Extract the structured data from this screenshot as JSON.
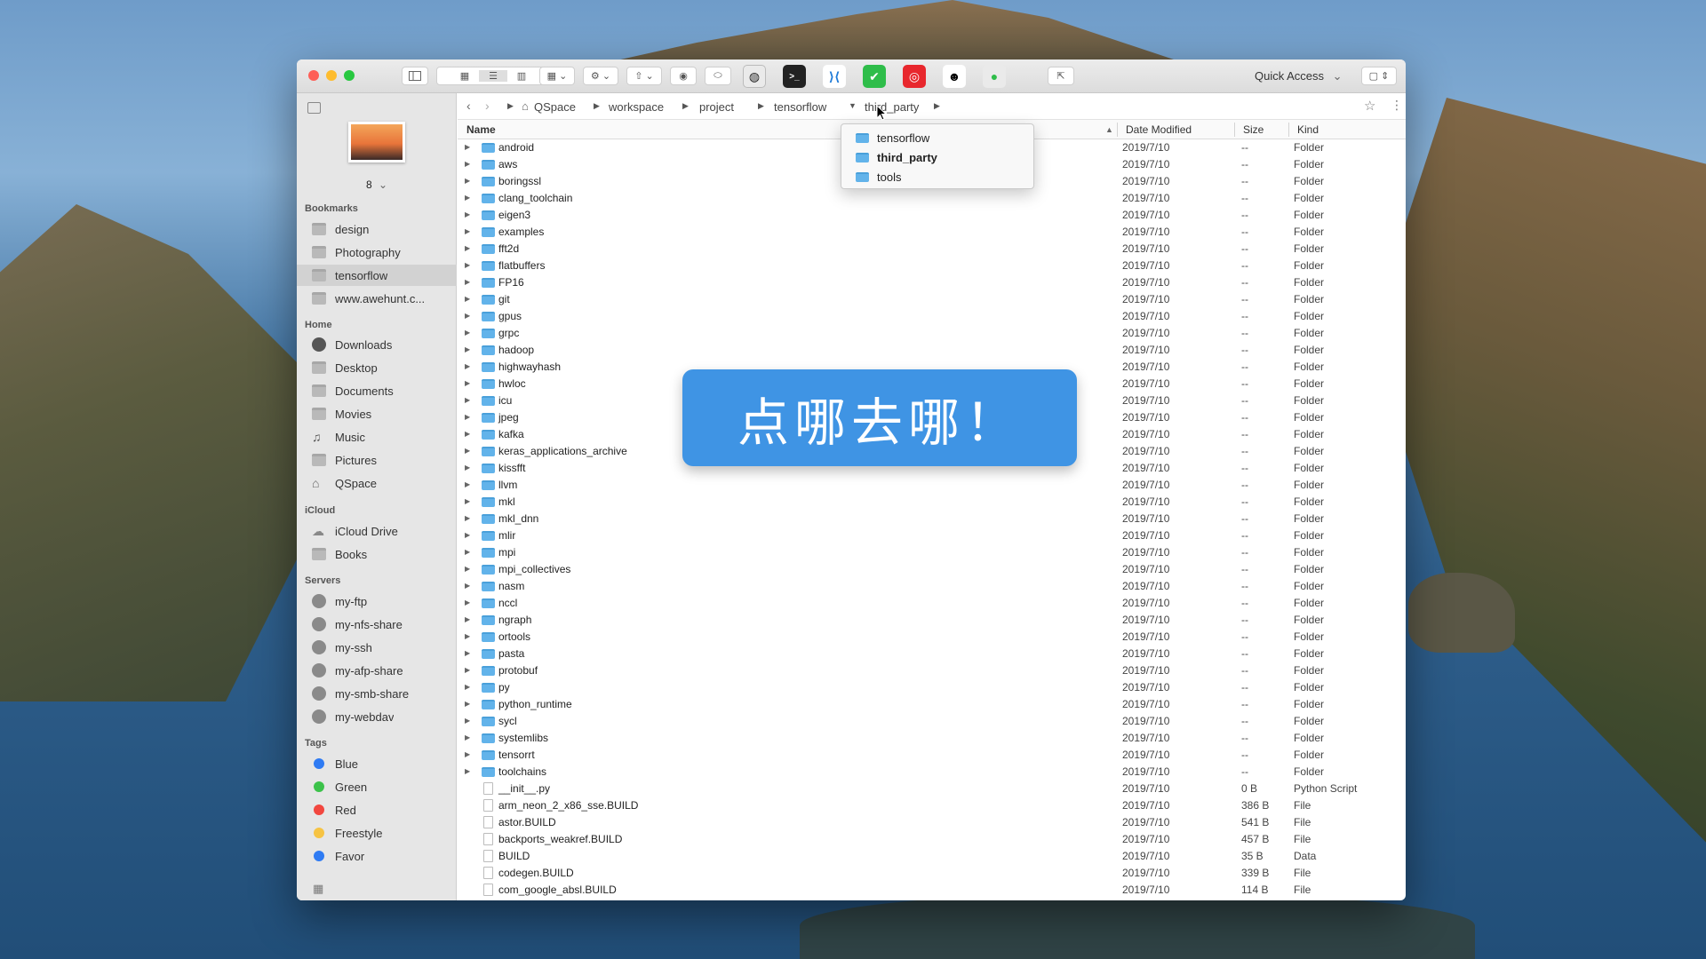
{
  "toolbar": {
    "quick_access_label": "Quick Access",
    "quick_access_chevron": "chevron-down-icon"
  },
  "sidebar": {
    "thumbnail_count": "8",
    "bookmarks_header": "Bookmarks",
    "bookmarks": [
      {
        "label": "design",
        "selected": false
      },
      {
        "label": "Photography",
        "selected": false
      },
      {
        "label": "tensorflow",
        "selected": true
      },
      {
        "label": "www.awehunt.c...",
        "selected": false
      }
    ],
    "home_header": "Home",
    "home": [
      {
        "label": "Downloads",
        "icon": "download-icon"
      },
      {
        "label": "Desktop",
        "icon": "desktop-icon"
      },
      {
        "label": "Documents",
        "icon": "documents-icon"
      },
      {
        "label": "Movies",
        "icon": "movies-icon"
      },
      {
        "label": "Music",
        "icon": "music-icon"
      },
      {
        "label": "Pictures",
        "icon": "pictures-icon"
      },
      {
        "label": "QSpace",
        "icon": "home-icon"
      }
    ],
    "icloud_header": "iCloud",
    "icloud": [
      {
        "label": "iCloud Drive",
        "icon": "cloud-icon"
      },
      {
        "label": "Books",
        "icon": "books-icon"
      }
    ],
    "servers_header": "Servers",
    "servers": [
      {
        "label": "my-ftp"
      },
      {
        "label": "my-nfs-share"
      },
      {
        "label": "my-ssh"
      },
      {
        "label": "my-afp-share"
      },
      {
        "label": "my-smb-share"
      },
      {
        "label": "my-webdav"
      }
    ],
    "tags_header": "Tags",
    "tags": [
      {
        "label": "Blue",
        "color": "#2f7bf3"
      },
      {
        "label": "Green",
        "color": "#3cc24a"
      },
      {
        "label": "Red",
        "color": "#f2473f"
      },
      {
        "label": "Freestyle",
        "color": "#f6c343"
      },
      {
        "label": "Favor",
        "color": "#2f7bf3"
      }
    ]
  },
  "pathbar": {
    "crumbs": [
      "QSpace",
      "workspace",
      "project",
      "tensorflow",
      "third_party"
    ]
  },
  "columns": {
    "name": "Name",
    "date": "Date Modified",
    "size": "Size",
    "kind": "Kind"
  },
  "dropdown": {
    "items": [
      {
        "label": "tensorflow",
        "bold": false
      },
      {
        "label": "third_party",
        "bold": true
      },
      {
        "label": "tools",
        "bold": false
      }
    ]
  },
  "banner": {
    "text": "点哪去哪！"
  },
  "files": [
    {
      "name": "android",
      "date": "2019/7/10",
      "size": "--",
      "kind": "Folder",
      "folder": true
    },
    {
      "name": "aws",
      "date": "2019/7/10",
      "size": "--",
      "kind": "Folder",
      "folder": true
    },
    {
      "name": "boringssl",
      "date": "2019/7/10",
      "size": "--",
      "kind": "Folder",
      "folder": true
    },
    {
      "name": "clang_toolchain",
      "date": "2019/7/10",
      "size": "--",
      "kind": "Folder",
      "folder": true
    },
    {
      "name": "eigen3",
      "date": "2019/7/10",
      "size": "--",
      "kind": "Folder",
      "folder": true
    },
    {
      "name": "examples",
      "date": "2019/7/10",
      "size": "--",
      "kind": "Folder",
      "folder": true
    },
    {
      "name": "fft2d",
      "date": "2019/7/10",
      "size": "--",
      "kind": "Folder",
      "folder": true
    },
    {
      "name": "flatbuffers",
      "date": "2019/7/10",
      "size": "--",
      "kind": "Folder",
      "folder": true
    },
    {
      "name": "FP16",
      "date": "2019/7/10",
      "size": "--",
      "kind": "Folder",
      "folder": true
    },
    {
      "name": "git",
      "date": "2019/7/10",
      "size": "--",
      "kind": "Folder",
      "folder": true
    },
    {
      "name": "gpus",
      "date": "2019/7/10",
      "size": "--",
      "kind": "Folder",
      "folder": true
    },
    {
      "name": "grpc",
      "date": "2019/7/10",
      "size": "--",
      "kind": "Folder",
      "folder": true
    },
    {
      "name": "hadoop",
      "date": "2019/7/10",
      "size": "--",
      "kind": "Folder",
      "folder": true
    },
    {
      "name": "highwayhash",
      "date": "2019/7/10",
      "size": "--",
      "kind": "Folder",
      "folder": true
    },
    {
      "name": "hwloc",
      "date": "2019/7/10",
      "size": "--",
      "kind": "Folder",
      "folder": true
    },
    {
      "name": "icu",
      "date": "2019/7/10",
      "size": "--",
      "kind": "Folder",
      "folder": true
    },
    {
      "name": "jpeg",
      "date": "2019/7/10",
      "size": "--",
      "kind": "Folder",
      "folder": true
    },
    {
      "name": "kafka",
      "date": "2019/7/10",
      "size": "--",
      "kind": "Folder",
      "folder": true
    },
    {
      "name": "keras_applications_archive",
      "date": "2019/7/10",
      "size": "--",
      "kind": "Folder",
      "folder": true
    },
    {
      "name": "kissfft",
      "date": "2019/7/10",
      "size": "--",
      "kind": "Folder",
      "folder": true
    },
    {
      "name": "llvm",
      "date": "2019/7/10",
      "size": "--",
      "kind": "Folder",
      "folder": true
    },
    {
      "name": "mkl",
      "date": "2019/7/10",
      "size": "--",
      "kind": "Folder",
      "folder": true
    },
    {
      "name": "mkl_dnn",
      "date": "2019/7/10",
      "size": "--",
      "kind": "Folder",
      "folder": true
    },
    {
      "name": "mlir",
      "date": "2019/7/10",
      "size": "--",
      "kind": "Folder",
      "folder": true
    },
    {
      "name": "mpi",
      "date": "2019/7/10",
      "size": "--",
      "kind": "Folder",
      "folder": true
    },
    {
      "name": "mpi_collectives",
      "date": "2019/7/10",
      "size": "--",
      "kind": "Folder",
      "folder": true
    },
    {
      "name": "nasm",
      "date": "2019/7/10",
      "size": "--",
      "kind": "Folder",
      "folder": true
    },
    {
      "name": "nccl",
      "date": "2019/7/10",
      "size": "--",
      "kind": "Folder",
      "folder": true
    },
    {
      "name": "ngraph",
      "date": "2019/7/10",
      "size": "--",
      "kind": "Folder",
      "folder": true
    },
    {
      "name": "ortools",
      "date": "2019/7/10",
      "size": "--",
      "kind": "Folder",
      "folder": true
    },
    {
      "name": "pasta",
      "date": "2019/7/10",
      "size": "--",
      "kind": "Folder",
      "folder": true
    },
    {
      "name": "protobuf",
      "date": "2019/7/10",
      "size": "--",
      "kind": "Folder",
      "folder": true
    },
    {
      "name": "py",
      "date": "2019/7/10",
      "size": "--",
      "kind": "Folder",
      "folder": true
    },
    {
      "name": "python_runtime",
      "date": "2019/7/10",
      "size": "--",
      "kind": "Folder",
      "folder": true
    },
    {
      "name": "sycl",
      "date": "2019/7/10",
      "size": "--",
      "kind": "Folder",
      "folder": true
    },
    {
      "name": "systemlibs",
      "date": "2019/7/10",
      "size": "--",
      "kind": "Folder",
      "folder": true
    },
    {
      "name": "tensorrt",
      "date": "2019/7/10",
      "size": "--",
      "kind": "Folder",
      "folder": true
    },
    {
      "name": "toolchains",
      "date": "2019/7/10",
      "size": "--",
      "kind": "Folder",
      "folder": true
    },
    {
      "name": "__init__.py",
      "date": "2019/7/10",
      "size": "0 B",
      "kind": "Python Script",
      "folder": false
    },
    {
      "name": "arm_neon_2_x86_sse.BUILD",
      "date": "2019/7/10",
      "size": "386 B",
      "kind": "File",
      "folder": false
    },
    {
      "name": "astor.BUILD",
      "date": "2019/7/10",
      "size": "541 B",
      "kind": "File",
      "folder": false
    },
    {
      "name": "backports_weakref.BUILD",
      "date": "2019/7/10",
      "size": "457 B",
      "kind": "File",
      "folder": false
    },
    {
      "name": "BUILD",
      "date": "2019/7/10",
      "size": "35 B",
      "kind": "Data",
      "folder": false
    },
    {
      "name": "codegen.BUILD",
      "date": "2019/7/10",
      "size": "339 B",
      "kind": "File",
      "folder": false
    },
    {
      "name": "com_google_absl.BUILD",
      "date": "2019/7/10",
      "size": "114 B",
      "kind": "File",
      "folder": false
    }
  ]
}
